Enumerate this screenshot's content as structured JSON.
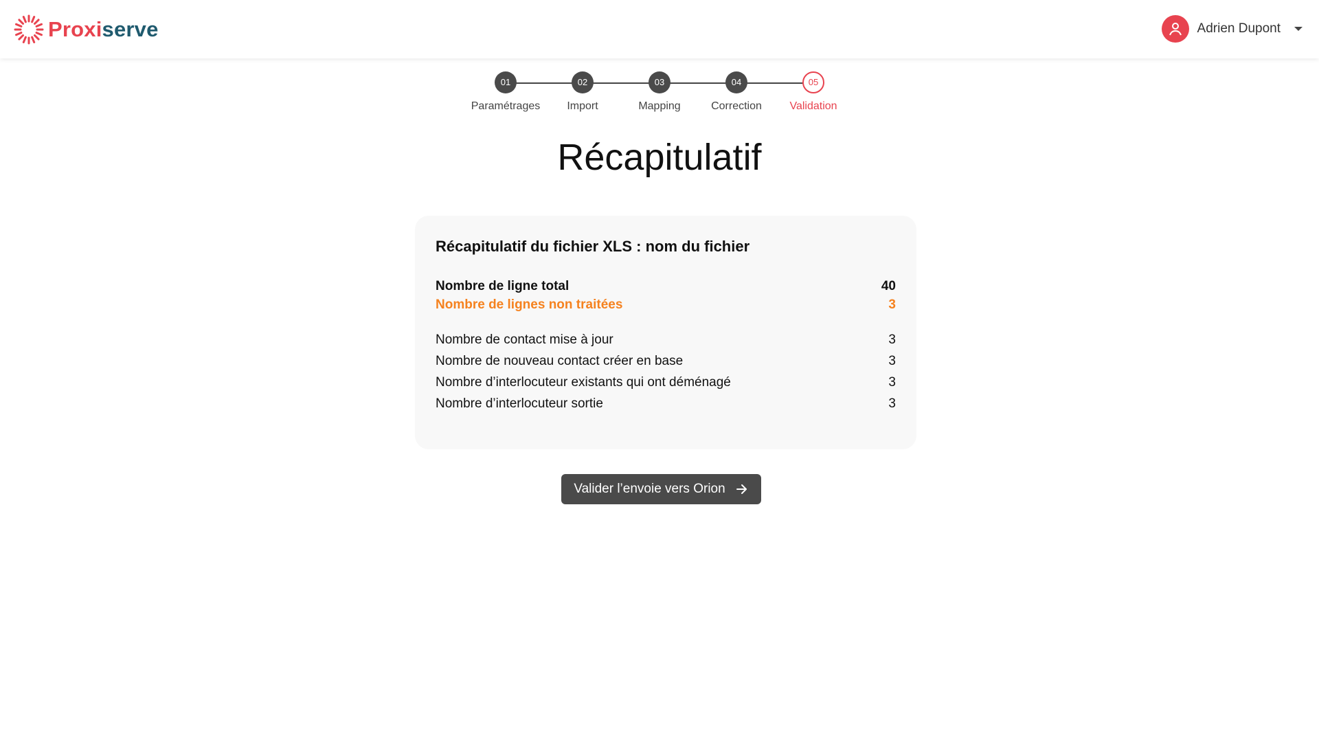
{
  "brand": {
    "part1": "Proxi",
    "part2": "serve",
    "accent": "#e8434f",
    "secondary": "#1f5a6e"
  },
  "user": {
    "name": "Adrien Dupont",
    "avatar_icon": "user-icon",
    "menu_icon": "chevron-down-icon"
  },
  "stepper": {
    "steps": [
      {
        "number": "01",
        "label": "Paramétrages"
      },
      {
        "number": "02",
        "label": "Import"
      },
      {
        "number": "03",
        "label": "Mapping"
      },
      {
        "number": "04",
        "label": "Correction"
      },
      {
        "number": "05",
        "label": "Validation"
      }
    ],
    "active_step": "05"
  },
  "page": {
    "title": "Récapitulatif"
  },
  "summary": {
    "title": "Récapitulatif du fichier XLS : nom du fichier",
    "total": {
      "label": "Nombre de ligne total",
      "value": "40"
    },
    "untreated": {
      "label": "Nombre de lignes non traitées",
      "value": "3",
      "color": "#f5821f"
    },
    "rows": [
      {
        "label": "Nombre de contact mise à jour",
        "value": "3"
      },
      {
        "label": "Nombre de nouveau contact créer en base",
        "value": "3"
      },
      {
        "label": "Nombre d’interlocuteur existants qui ont déménagé",
        "value": "3"
      },
      {
        "label": "Nombre d’interlocuteur sortie",
        "value": "3"
      }
    ]
  },
  "actions": {
    "submit_label": "Valider l’envoie vers Orion",
    "submit_icon": "arrow-right-icon"
  }
}
